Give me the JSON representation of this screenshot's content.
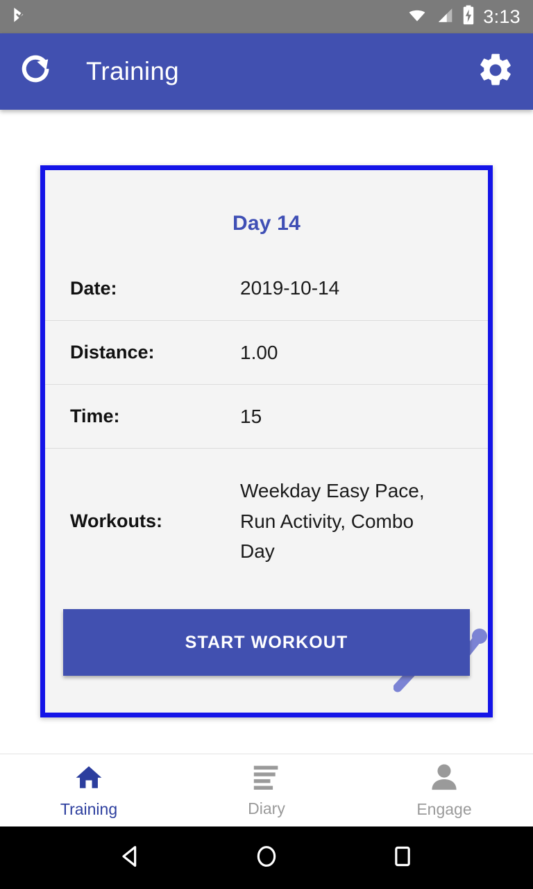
{
  "status_bar": {
    "notification_icon": "play-store-check-icon",
    "wifi_icon": "wifi-icon",
    "cellular_icon": "cellular-signal-icon",
    "battery_icon": "battery-charging-icon",
    "time": "3:13",
    "background_color": "#7b7b7b"
  },
  "app_bar": {
    "refresh_icon": "refresh-icon",
    "title": "Training",
    "settings_icon": "gear-icon",
    "background_color": "#4150b0"
  },
  "card": {
    "border_color": "#1414e8",
    "background_color": "#f4f4f4",
    "day_title": "Day 14",
    "day_title_color": "#3f4fb5",
    "watermark_icon": "trending-line-chart-icon",
    "watermark_color": "#7b83d4",
    "rows": [
      {
        "label": "Date:",
        "value": "2019-10-14"
      },
      {
        "label": "Distance:",
        "value": "1.00"
      },
      {
        "label": "Time:",
        "value": "15"
      },
      {
        "label": "Workouts:",
        "value": "Weekday Easy Pace,  Run Activity,  Combo Day"
      }
    ],
    "start_button": {
      "label": "START WORKOUT",
      "background_color": "#4150b0",
      "text_color": "#ffffff"
    }
  },
  "bottom_nav": {
    "active_color": "#2c3e9e",
    "inactive_color": "#9a9a9a",
    "items": [
      {
        "label": "Training",
        "icon": "home-icon",
        "active": true
      },
      {
        "label": "Diary",
        "icon": "list-lines-icon",
        "active": false
      },
      {
        "label": "Engage",
        "icon": "person-icon",
        "active": false
      }
    ]
  },
  "android_nav": {
    "back_icon": "back-triangle-icon",
    "home_icon": "home-circle-icon",
    "recents_icon": "recents-square-icon",
    "background_color": "#000000"
  }
}
